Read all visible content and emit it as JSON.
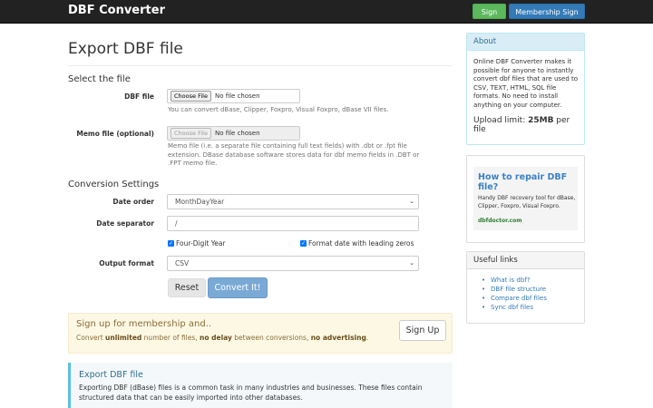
{
  "navbar": {
    "brand": "DBF Converter",
    "signin_label": "Sign in",
    "membership_label": "Membership Sign up"
  },
  "main": {
    "title": "Export DBF file",
    "select_file": {
      "section_title": "Select the file",
      "dbf_label": "DBF file",
      "dbf_choose": "Choose File",
      "dbf_status": "No file chosen",
      "dbf_help": "You can convert dBase, Clipper, Foxpro, Visual Foxpro, dBase VII files.",
      "memo_label": "Memo file (optional)",
      "memo_choose": "Choose File",
      "memo_status": "No file chosen",
      "memo_help_1": "Memo file (i.e. a separate file containing full text fields) with .dbt or .fpt file",
      "memo_help_2": "extension. DBase database software stores data for dbf memo fields in .DBT or",
      "memo_help_3": ".FPT memo file."
    },
    "settings": {
      "section_title": "Conversion Settings",
      "date_order_label": "Date order",
      "date_order_value": "MonthDayYear",
      "date_sep_label": "Date separator",
      "date_sep_value": "/",
      "four_digit_label": "Four-Digit Year",
      "leading_zeros_label": "Format date with leading zeros",
      "output_format_label": "Output format",
      "output_format_value": "CSV",
      "reset_label": "Reset",
      "convert_label": "Convert It!"
    },
    "promo": {
      "title": "Sign up for membership and..",
      "text_1": "Convert ",
      "text_b1": "unlimited",
      "text_2": " number of files, ",
      "text_b2": "no delay",
      "text_3": " between conversions, ",
      "text_b3": "no advertising",
      "text_4": ".",
      "signup_label": "Sign Up"
    },
    "info": {
      "title": "Export DBF file",
      "text": "Exporting DBF (dBase) files is a common task in many industries and businesses. These files contain structured data that can be easily imported into other databases."
    }
  },
  "sidebar": {
    "about": {
      "heading": "About",
      "text": "Online DBF Converter makes it possible for anyone to instantly convert dbf files that are used to CSV, TEXT, HTML, SQL file formats. No need to install anything on your computer.",
      "upload_prefix": "Upload limit: ",
      "upload_value": "25MB",
      "upload_suffix": " per file"
    },
    "ad": {
      "title": "How to repair DBF file?",
      "text": "Handy DBF recovery tool for dBase, Clipper, Foxpro, Visual Foxpro.",
      "link": "dbfdoctor.com"
    },
    "useful_links": {
      "heading": "Useful links",
      "items": [
        "What is dbf?",
        "DBF file structure",
        "Compare dbf files",
        "Sync dbf files"
      ]
    }
  },
  "colors": {
    "navbar_bg": "#222222",
    "success": "#5cb85c",
    "primary": "#337ab7",
    "warning_bg": "#fcf8e3",
    "info_border": "#5bc0de"
  }
}
